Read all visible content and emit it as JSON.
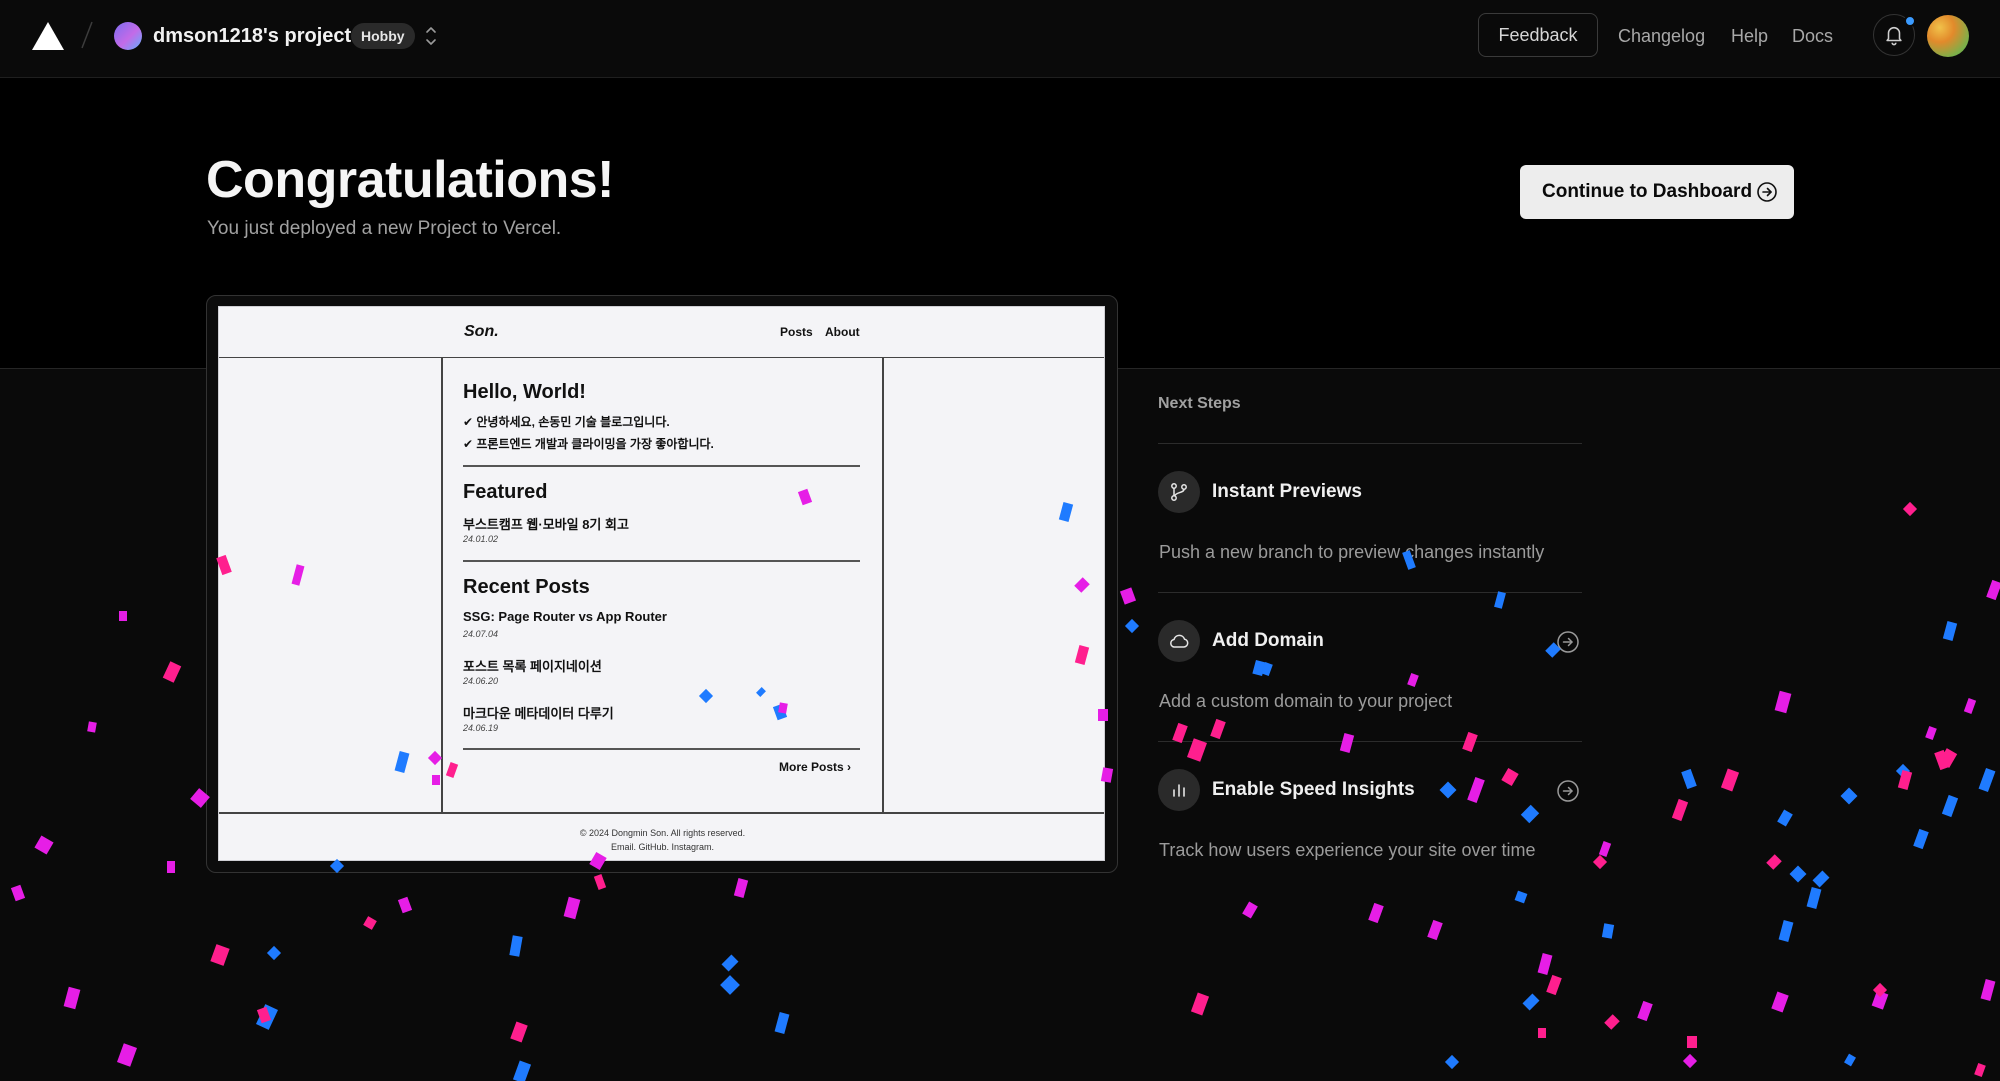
{
  "topbar": {
    "team_name": "dmson1218's projects",
    "plan": "Hobby",
    "feedback_label": "Feedback",
    "nav": [
      "Changelog",
      "Help",
      "Docs"
    ]
  },
  "hero": {
    "title": "Congratulations!",
    "subtitle": "You just deployed a new Project to Vercel.",
    "continue_label": "Continue to Dashboard"
  },
  "preview": {
    "brand": "Son.",
    "nav": [
      "Posts",
      "About"
    ],
    "hello": "Hello, World!",
    "intro": [
      "✔ 안녕하세요, 손동민 기술 블로그입니다.",
      "✔ 프론트엔드 개발과 클라이밍을 가장 좋아합니다."
    ],
    "featured_heading": "Featured",
    "featured": {
      "title": "부스트캠프 웹·모바일 8기 회고",
      "date": "24.01.02"
    },
    "recent_heading": "Recent Posts",
    "recent": [
      {
        "title": "SSG: Page Router vs App Router",
        "date": "24.07.04"
      },
      {
        "title": "포스트 목록 페이지네이션",
        "date": "24.06.20"
      },
      {
        "title": "마크다운 메타데이터 다루기",
        "date": "24.06.19"
      }
    ],
    "more": "More Posts ›",
    "copyright": "© 2024 Dongmin Son. All rights reserved.",
    "links": "Email.  GitHub.  Instagram."
  },
  "next_steps": {
    "heading": "Next Steps",
    "items": [
      {
        "title": "Instant Previews",
        "desc": "Push a new branch to preview changes instantly",
        "icon": "git-branch-icon"
      },
      {
        "title": "Add Domain",
        "desc": "Add a custom domain to your project",
        "icon": "cloud-icon"
      },
      {
        "title": "Enable Speed Insights",
        "desc": "Track how users experience your site over time",
        "icon": "bar-chart-icon"
      }
    ]
  },
  "colors": {
    "confetti_pink": "#ff1f8e",
    "confetti_magenta": "#e61ee6",
    "confetti_blue": "#1f7bff",
    "accent_dot": "#3b9bff"
  }
}
